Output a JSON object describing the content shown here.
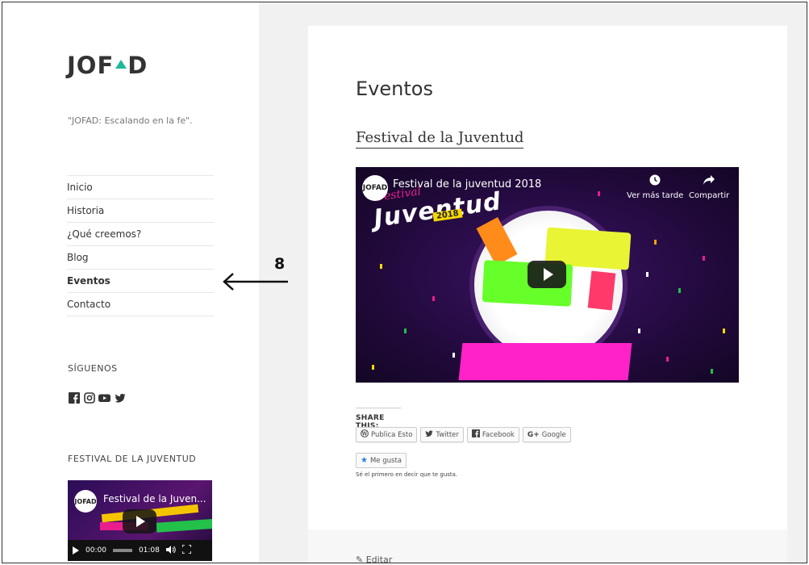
{
  "site": {
    "logo_text_left": "JOF",
    "logo_text_right": "D",
    "tagline": "\"JOFAD: Escalando en la fe\"."
  },
  "menu": {
    "items": [
      {
        "label": "Inicio"
      },
      {
        "label": "Historia"
      },
      {
        "label": "¿Qué creemos?"
      },
      {
        "label": "Blog"
      },
      {
        "label": "Eventos",
        "active": true
      },
      {
        "label": "Contacto"
      }
    ]
  },
  "annotation": {
    "number": "8"
  },
  "widgets": {
    "follow_title": "SÍGUENOS",
    "social_icons": [
      "facebook-icon",
      "instagram-icon",
      "youtube-icon",
      "twitter-icon"
    ],
    "festival_title": "FESTIVAL DE LA JUVENTUD",
    "thumb": {
      "logo": "JOFAD",
      "title": "Festival de la Juven...",
      "time_current": "00:00",
      "time_total": "01:08"
    }
  },
  "main": {
    "page_title": "Eventos",
    "post_title": "Festival de la Juventud",
    "video": {
      "logo": "JOFAD",
      "title": "Festival de la juventud 2018",
      "brand_festival": "Festival",
      "brand_juventud": "Juventud",
      "brand_year": "2018",
      "watch_later": "Ver más tarde",
      "share": "Compartir"
    },
    "share": {
      "label": "SHARE THIS:",
      "buttons": [
        {
          "label": "Publica Esto",
          "icon": "wordpress-icon"
        },
        {
          "label": "Twitter",
          "icon": "twitter-icon"
        },
        {
          "label": "Facebook",
          "icon": "facebook-icon"
        },
        {
          "label": "Google",
          "icon": "google-plus-icon"
        }
      ]
    },
    "like": {
      "label": "Me gusta",
      "note": "Sé el primero en decir que te gusta."
    },
    "edit_label": "Editar"
  },
  "colors": {
    "accent_teal": "#1fb89a",
    "video_bg": "#220a3d",
    "neon_pink": "#e91e8c",
    "neon_yellow": "#f5d800"
  }
}
